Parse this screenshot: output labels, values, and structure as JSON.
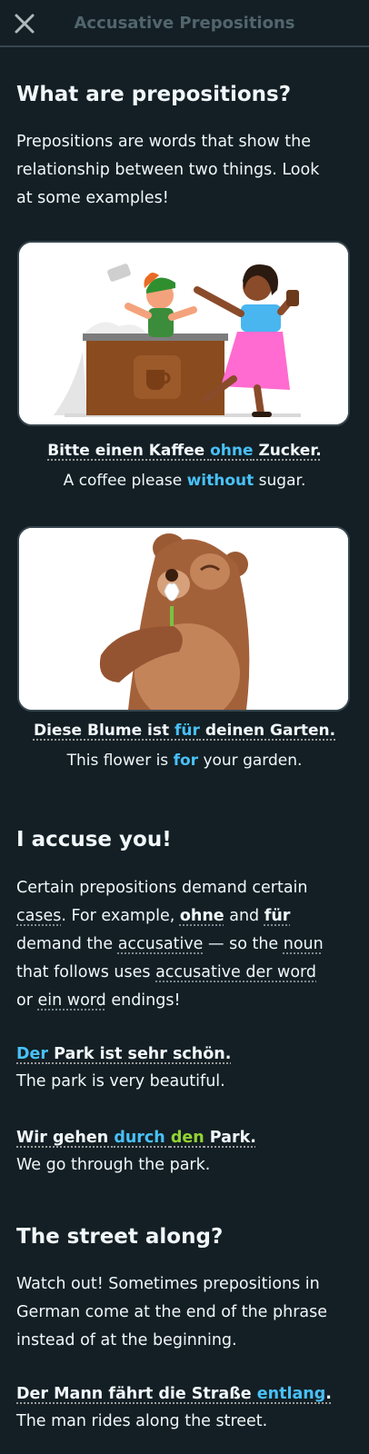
{
  "header": {
    "title": "Accusative Prepositions",
    "close_icon": "close-icon"
  },
  "section1": {
    "heading": "What are prepositions?",
    "intro_line1": "Prepositions are words that show the",
    "intro_line2": "relationship between two things. Look",
    "intro_line3": "at some examples!",
    "example1": {
      "de_pre": "Bitte einen Kaffee ",
      "de_hl": "ohne",
      "de_post": " Zucker.",
      "en_pre": "A coffee please ",
      "en_hl": "without",
      "en_post": " sugar."
    },
    "example2": {
      "de_pre": "Diese Blume ist ",
      "de_hl": "für",
      "de_post": " deinen Garten.",
      "en_pre": "This flower is ",
      "en_hl": "for",
      "en_post": " your garden."
    }
  },
  "section2": {
    "heading": "I accuse you!",
    "l1": "Certain prepositions demand certain",
    "l2_cases": "cases",
    "l2_mid": ". For example, ",
    "l2_ohne": "ohne",
    "l2_and": " and ",
    "l2_fuer": "für",
    "l3_pre": "demand the ",
    "l3_acc": "accusative",
    "l3_mid": " — so the ",
    "l3_noun": "noun",
    "l4_pre": "that follows uses ",
    "l4_acc": "accusative der word",
    "l5_pre": "or ",
    "l5_ein": "ein word",
    "l5_post": " endings!",
    "ex1_de_hl": "Der",
    "ex1_de_post": " Park ist sehr schön.",
    "ex1_en": "The park is very beautiful.",
    "ex2_de_pre": "Wir gehen ",
    "ex2_de_hl1": "durch",
    "ex2_de_sp": " ",
    "ex2_de_hl2": "den",
    "ex2_de_post": " Park.",
    "ex2_en": "We go through the park."
  },
  "section3": {
    "heading": "The street along?",
    "l1": "Watch out! Sometimes prepositions in",
    "l2": "German come at the end of the phrase",
    "l3": "instead of at the beginning.",
    "ex_de_pre": "Der Mann fährt die Straße ",
    "ex_de_hl": "entlang",
    "ex_de_post": ".",
    "ex_en": "The man rides along the street."
  },
  "colors": {
    "background": "#131f24",
    "text": "#f1f7fb",
    "accent_blue": "#49c0f8",
    "accent_green": "#93d333",
    "header_title": "#52656d"
  }
}
